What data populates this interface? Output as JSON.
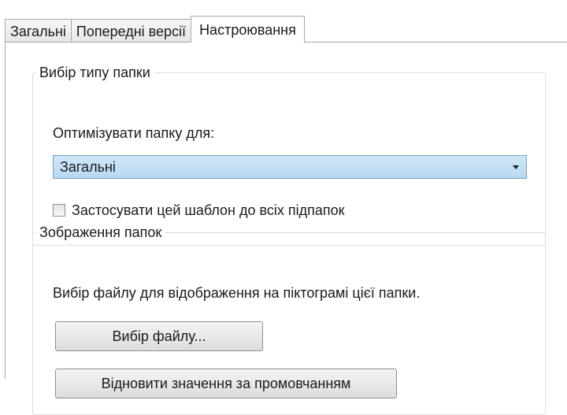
{
  "tabs": [
    {
      "label": "Загальні"
    },
    {
      "label": "Попередні версії"
    },
    {
      "label": "Настроювання"
    }
  ],
  "folder_type": {
    "title": "Вибір типу папки",
    "optimize_label": "Оптимізувати папку для:",
    "selected_option": "Загальні",
    "apply_subfolders_label": "Застосувати цей шаблон до всіх підпапок",
    "apply_subfolders_checked": false
  },
  "folder_pictures": {
    "title": "Зображення папок",
    "description": "Вибір файлу для відображення на піктограмі цієї папки.",
    "choose_file_button": "Вибір файлу...",
    "restore_default_button": "Відновити значення за промовчанням"
  }
}
